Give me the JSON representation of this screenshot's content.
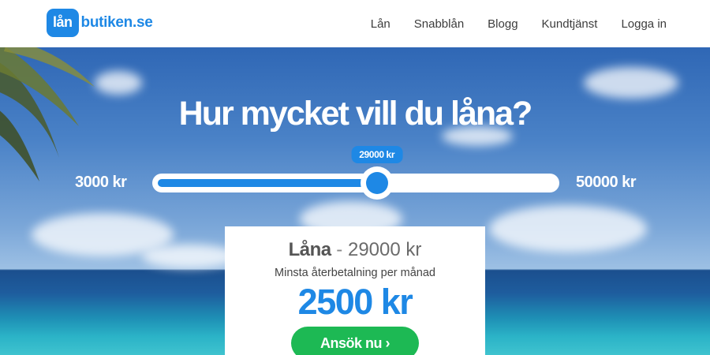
{
  "brand": {
    "badge": "lån",
    "name": "butiken.se"
  },
  "nav": {
    "items": [
      "Lån",
      "Snabblån",
      "Blogg",
      "Kundtjänst",
      "Logga in"
    ]
  },
  "hero": {
    "title": "Hur mycket vill du låna?",
    "min_label": "3000 kr",
    "max_label": "50000 kr",
    "min_value": 3000,
    "max_value": 50000,
    "current_value": 29000,
    "tooltip": "29000 kr"
  },
  "result": {
    "loan_word": "Låna",
    "separator": " - ",
    "loan_amount": "29000 kr",
    "subtitle": "Minsta återbetalning per månad",
    "monthly_amount": "2500 kr",
    "apply_label": "Ansök nu ›"
  },
  "colors": {
    "accent": "#1e88e5",
    "apply": "#1db954"
  },
  "icons": {
    "logo": "lanbutiken-logo",
    "palm": "palm-tree-decoration"
  }
}
